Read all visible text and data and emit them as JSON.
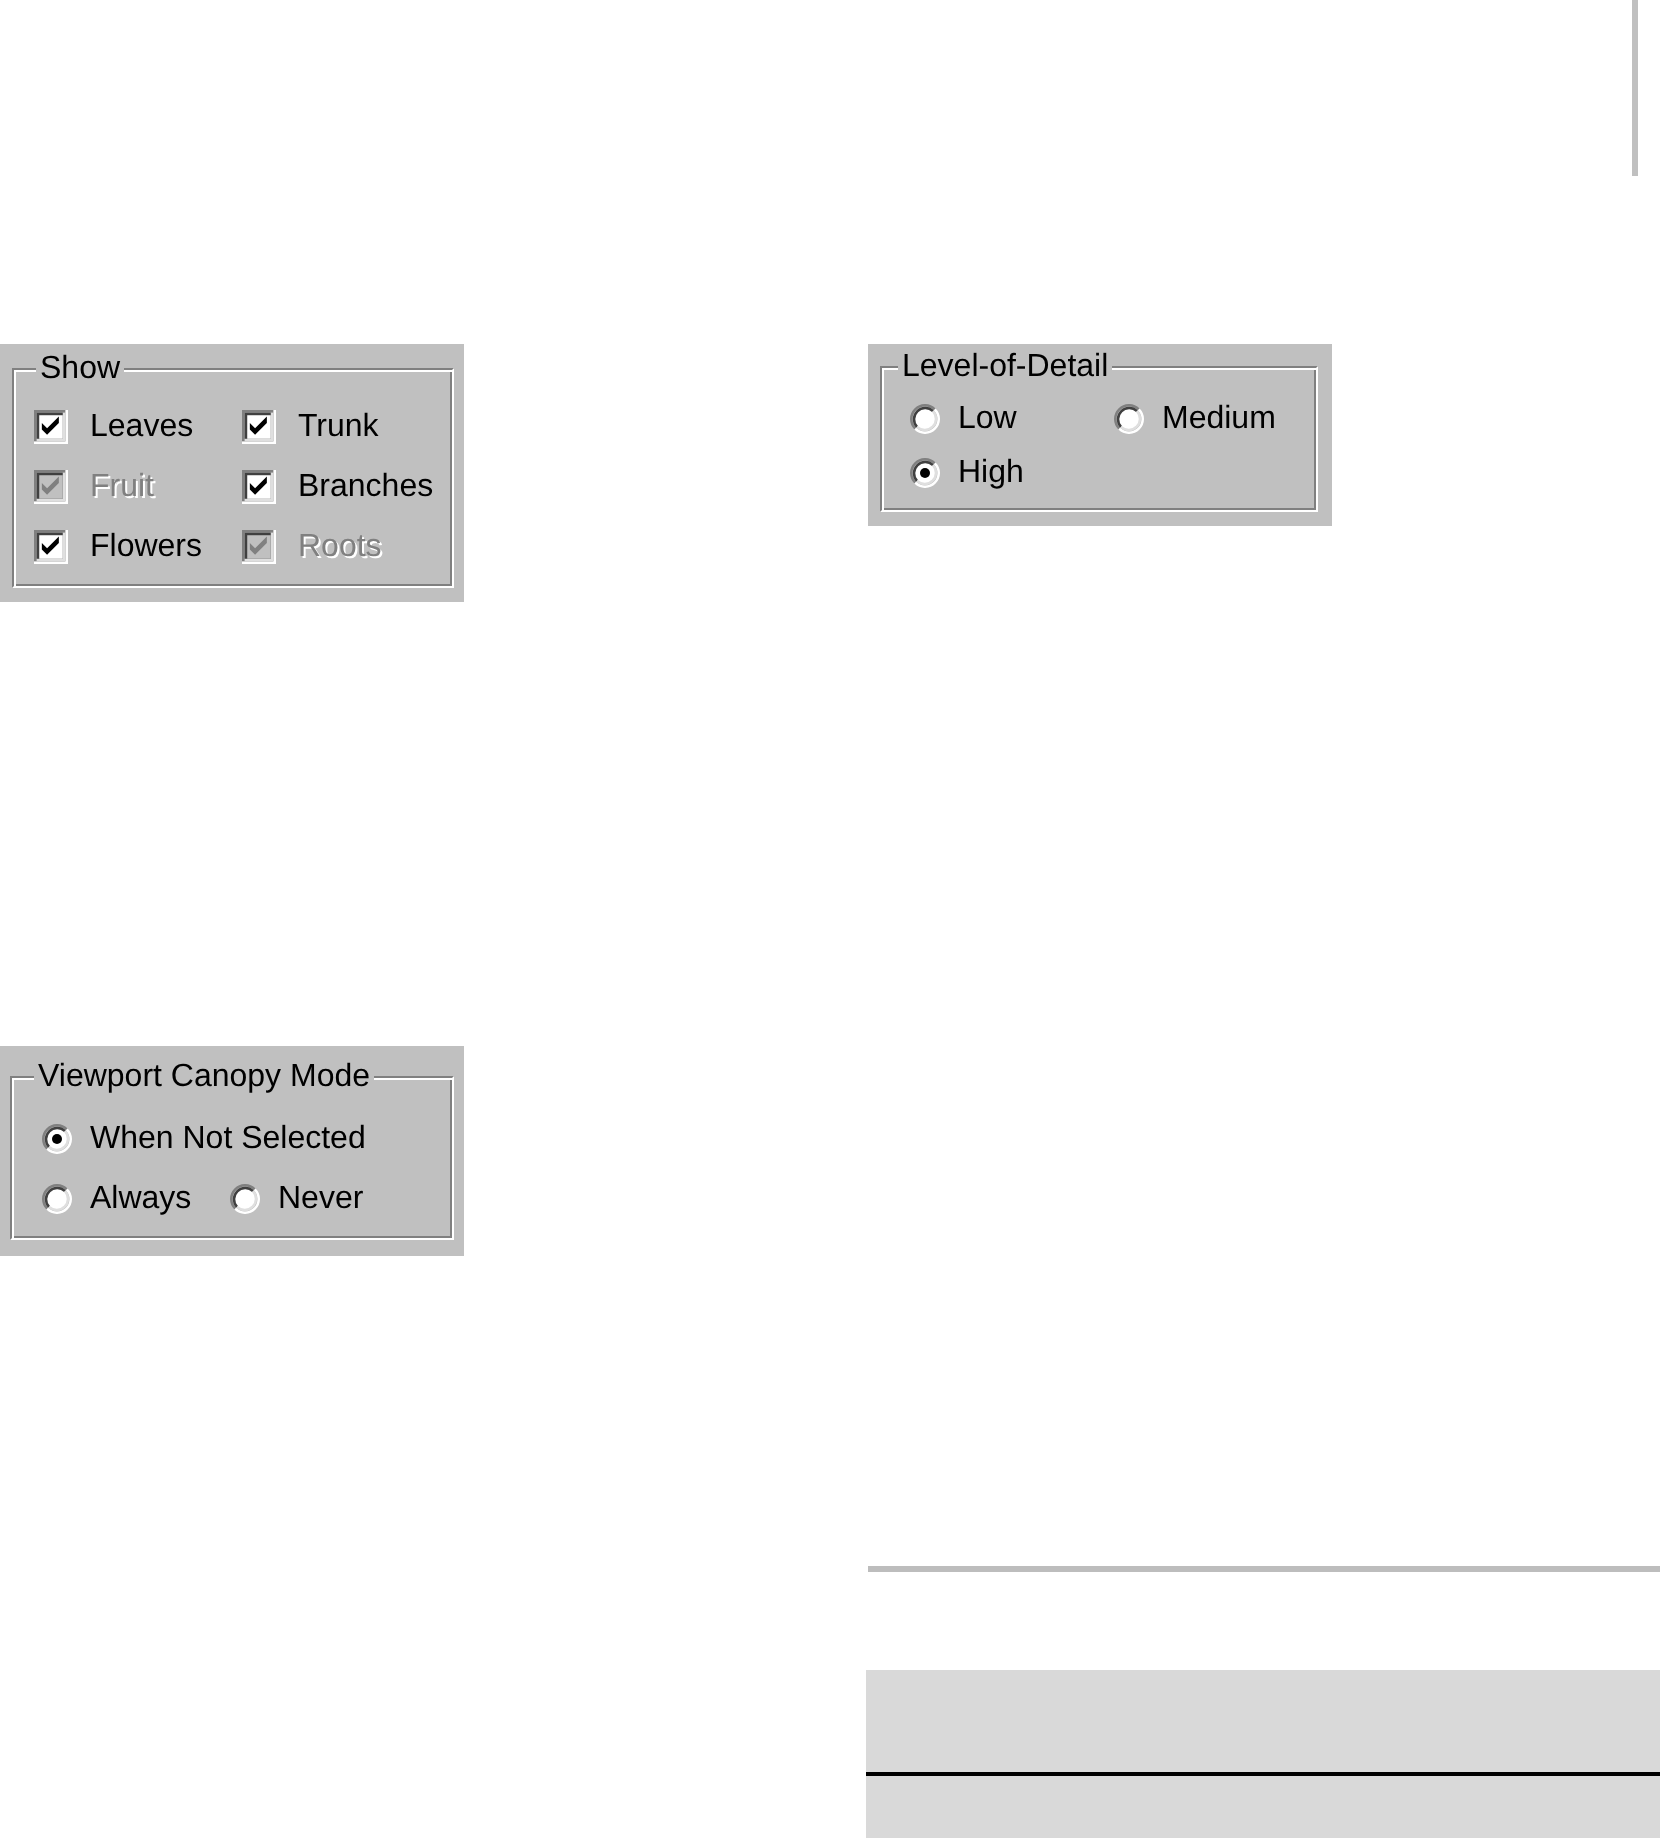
{
  "show_group": {
    "title": "Show",
    "items": [
      {
        "label": "Leaves",
        "checked": true,
        "disabled": false
      },
      {
        "label": "Trunk",
        "checked": true,
        "disabled": false
      },
      {
        "label": "Fruit",
        "checked": true,
        "disabled": true
      },
      {
        "label": "Branches",
        "checked": true,
        "disabled": false
      },
      {
        "label": "Flowers",
        "checked": true,
        "disabled": false
      },
      {
        "label": "Roots",
        "checked": true,
        "disabled": true
      }
    ]
  },
  "level_of_detail_group": {
    "title": "Level-of-Detail",
    "options": [
      {
        "label": "Low",
        "selected": false
      },
      {
        "label": "Medium",
        "selected": false
      },
      {
        "label": "High",
        "selected": true
      }
    ]
  },
  "viewport_canopy_mode_group": {
    "title": "Viewport Canopy Mode",
    "options": [
      {
        "label": "When Not Selected",
        "selected": true
      },
      {
        "label": "Always",
        "selected": false
      },
      {
        "label": "Never",
        "selected": false
      }
    ]
  }
}
